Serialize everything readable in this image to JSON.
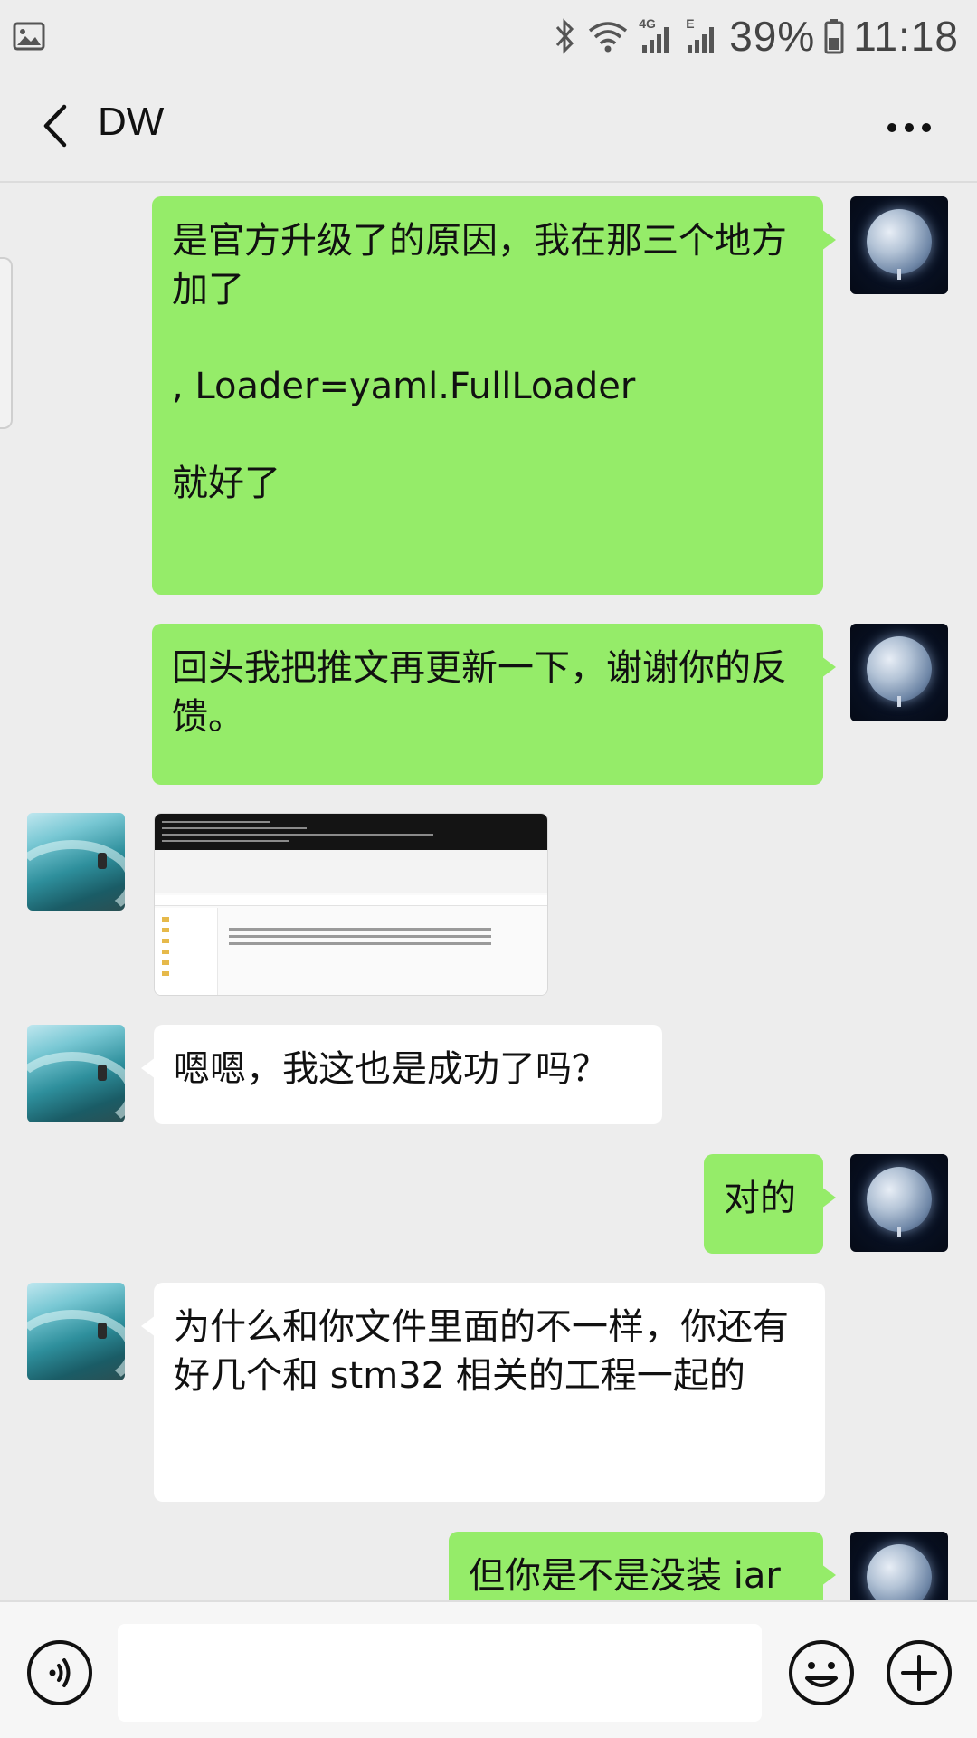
{
  "status_bar": {
    "gallery_icon": "image-icon",
    "bluetooth_icon": "bluetooth-icon",
    "wifi_icon": "wifi-icon",
    "signal_4g_label": "4G",
    "signal_e_label": "E",
    "battery_percent": "39%",
    "time": "11:18"
  },
  "header": {
    "back_icon": "chevron-left-icon",
    "title": "DW",
    "more_icon": "more-dots-icon"
  },
  "messages": [
    {
      "sender": "self",
      "type": "text",
      "paragraphs": [
        "是官方升级了的原因，我在那三个地方加了",
        ", Loader=yaml.FullLoader",
        "就好了"
      ]
    },
    {
      "sender": "self",
      "type": "text",
      "paragraphs": [
        "回头我把推文再更新一下，谢谢你的反馈。"
      ]
    },
    {
      "sender": "other",
      "type": "image"
    },
    {
      "sender": "other",
      "type": "text",
      "paragraphs": [
        "嗯嗯，我这也是成功了吗？"
      ]
    },
    {
      "sender": "self",
      "type": "text",
      "paragraphs": [
        "对的"
      ]
    },
    {
      "sender": "other",
      "type": "text",
      "paragraphs": [
        "为什么和你文件里面的不一样，你还有好几个和 stm32 相关的工程一起的"
      ]
    },
    {
      "sender": "self",
      "type": "text",
      "paragraphs": [
        "但你是不是没装 iar"
      ]
    }
  ],
  "input_bar": {
    "voice_icon": "voice-icon",
    "input_value": "",
    "emoji_icon": "emoji-icon",
    "plus_icon": "plus-icon"
  },
  "colors": {
    "self_bubble": "#95ec69",
    "other_bubble": "#ffffff",
    "background": "#ededed"
  }
}
